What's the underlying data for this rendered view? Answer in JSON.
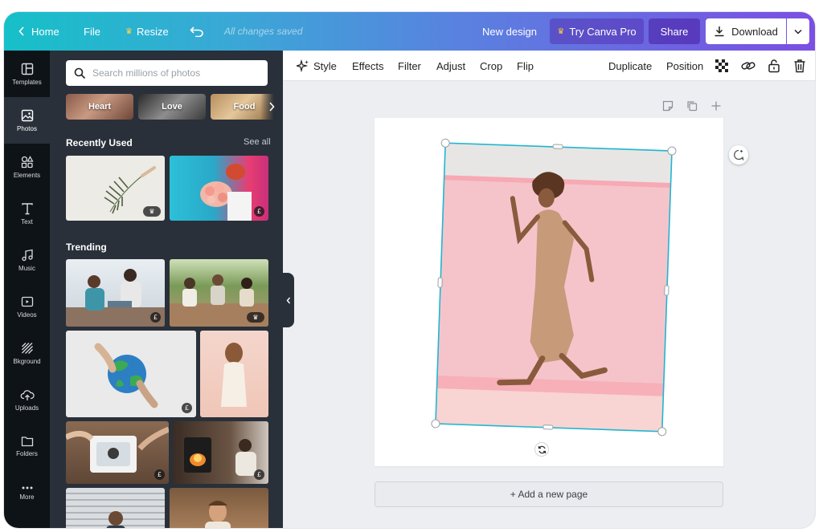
{
  "topbar": {
    "home_label": "Home",
    "file_label": "File",
    "resize_label": "Resize",
    "saved_status": "All changes saved",
    "design_name": "New design",
    "try_pro_label": "Try Canva Pro",
    "share_label": "Share",
    "download_label": "Download"
  },
  "rail": [
    {
      "label": "Templates",
      "icon": "templates-icon"
    },
    {
      "label": "Photos",
      "icon": "photos-icon"
    },
    {
      "label": "Elements",
      "icon": "elements-icon"
    },
    {
      "label": "Text",
      "icon": "text-icon"
    },
    {
      "label": "Music",
      "icon": "music-icon"
    },
    {
      "label": "Videos",
      "icon": "videos-icon"
    },
    {
      "label": "Bkground",
      "icon": "background-icon"
    },
    {
      "label": "Uploads",
      "icon": "uploads-icon"
    },
    {
      "label": "Folders",
      "icon": "folders-icon"
    },
    {
      "label": "More",
      "icon": "more-icon"
    }
  ],
  "panel": {
    "search_placeholder": "Search millions of photos",
    "chips": [
      "Heart",
      "Love",
      "Food"
    ],
    "recently_used_title": "Recently Used",
    "see_all_label": "See all",
    "trending_title": "Trending",
    "badges": {
      "pro": "♛",
      "paid": "£"
    }
  },
  "toolbar": {
    "style_label": "Style",
    "effects_label": "Effects",
    "filter_label": "Filter",
    "adjust_label": "Adjust",
    "crop_label": "Crop",
    "flip_label": "Flip",
    "duplicate_label": "Duplicate",
    "position_label": "Position"
  },
  "canvas": {
    "add_page_label": "+ Add a new page"
  },
  "colors": {
    "gradient_start": "#16c0c8",
    "gradient_end": "#7b4fe2",
    "panel_bg": "#293039",
    "rail_bg": "#0e1318",
    "selection": "#1fb6d2"
  }
}
